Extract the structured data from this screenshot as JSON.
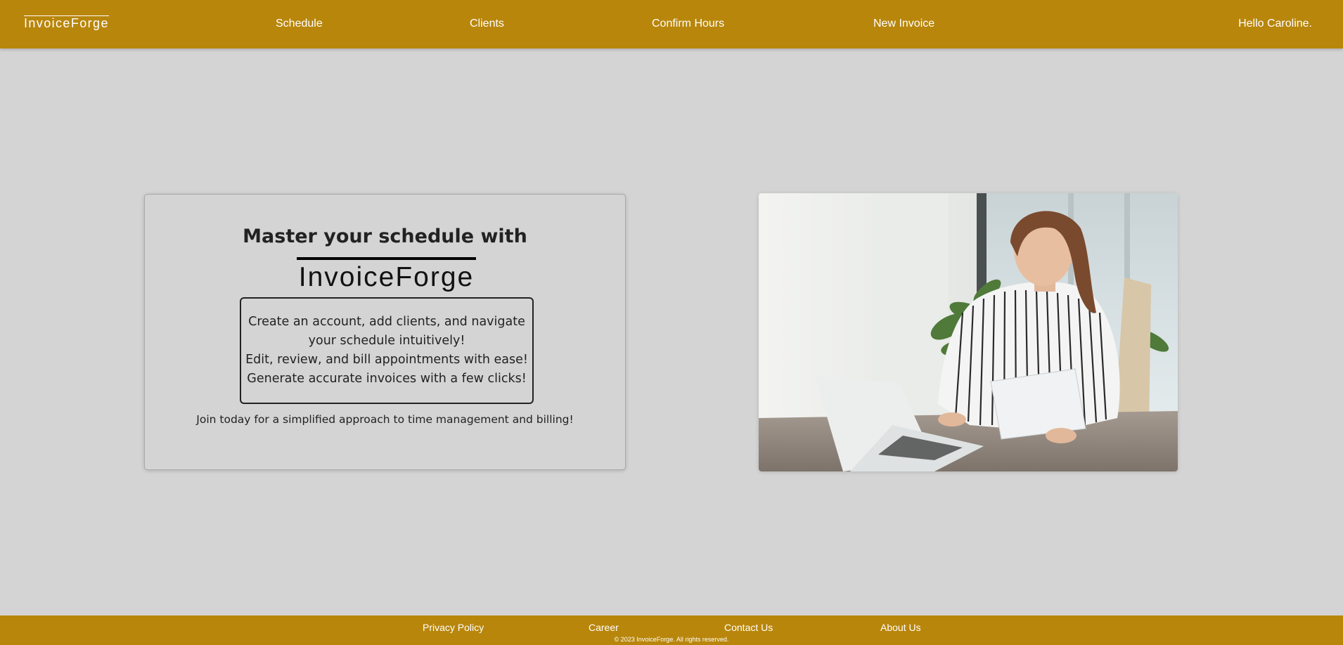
{
  "header": {
    "logo": "InvoiceForge",
    "nav": [
      {
        "label": "Schedule"
      },
      {
        "label": "Clients"
      },
      {
        "label": "Confirm Hours"
      },
      {
        "label": "New Invoice"
      }
    ],
    "greeting": "Hello Caroline."
  },
  "hero": {
    "headline": "Master your schedule with",
    "brand": "InvoiceForge",
    "features": [
      "Create an account, add clients, and navigate",
      "your schedule intuitively!",
      "Edit, review, and bill appointments with ease!",
      "Generate accurate invoices with a few clicks!"
    ],
    "cta_text": "Join today for a simplified approach to time management and billing!"
  },
  "image": {
    "icon": "office-woman-laptop-photo"
  },
  "footer": {
    "links": [
      {
        "label": "Privacy Policy"
      },
      {
        "label": "Career"
      },
      {
        "label": "Contact Us"
      },
      {
        "label": "About Us"
      }
    ],
    "copyright": "© 2023 InvoiceForge. All rights reserved."
  },
  "colors": {
    "accent": "#b8860b",
    "background": "#d4d4d4"
  }
}
